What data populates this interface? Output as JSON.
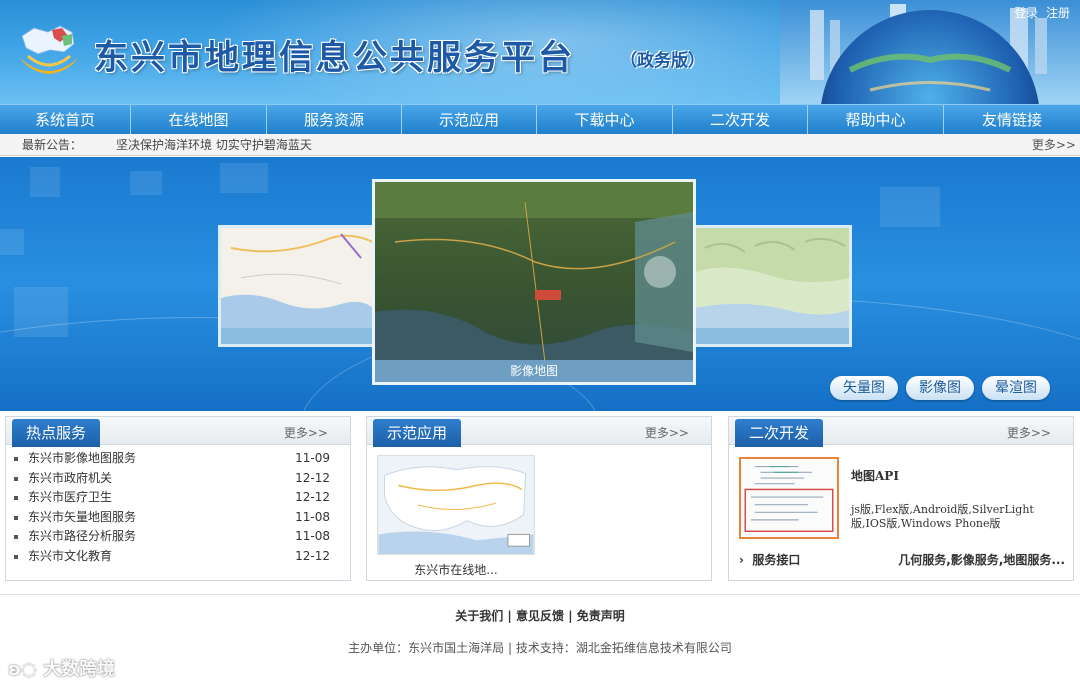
{
  "header": {
    "title": "东兴市地理信息公共服务平台",
    "edition": "（政务版）",
    "login": "登录",
    "register": "注册"
  },
  "nav": {
    "items": [
      "系统首页",
      "在线地图",
      "服务资源",
      "示范应用",
      "下载中心",
      "二次开发",
      "帮助中心",
      "友情链接"
    ]
  },
  "notice": {
    "label": "最新公告：",
    "text": "坚决保护海洋环境 切实守护碧海蓝天",
    "more": "更多>>"
  },
  "banner": {
    "center_caption": "影像地图",
    "buttons": [
      "矢量图",
      "影像图",
      "晕渲图"
    ]
  },
  "hot_services": {
    "title": "热点服务",
    "more": "更多>>",
    "items": [
      {
        "name": "东兴市影像地图服务",
        "date": "11-09"
      },
      {
        "name": "东兴市政府机关",
        "date": "12-12"
      },
      {
        "name": "东兴市医疗卫生",
        "date": "12-12"
      },
      {
        "name": "东兴市矢量地图服务",
        "date": "11-08"
      },
      {
        "name": "东兴市路径分析服务",
        "date": "11-08"
      },
      {
        "name": "东兴市文化教育",
        "date": "12-12"
      }
    ]
  },
  "demo_apps": {
    "title": "示范应用",
    "more": "更多>>",
    "caption": "东兴市在线地..."
  },
  "dev": {
    "title": "二次开发",
    "more": "更多>>",
    "api_title": "地图API",
    "api_desc": "js版,Flex版,Android版,SilverLight版,IOS版,Windows Phone版",
    "service_label": "服务接口",
    "service_value": "几何服务,影像服务,地图服务..."
  },
  "footer": {
    "links": [
      "关于我们",
      "意见反馈",
      "免责声明"
    ],
    "host_label": "主办单位：",
    "host": "东兴市国土海洋局",
    "support_label": "技术支持：",
    "support": "湖北金拓维信息技术有限公司"
  },
  "watermark": "大数跨境"
}
